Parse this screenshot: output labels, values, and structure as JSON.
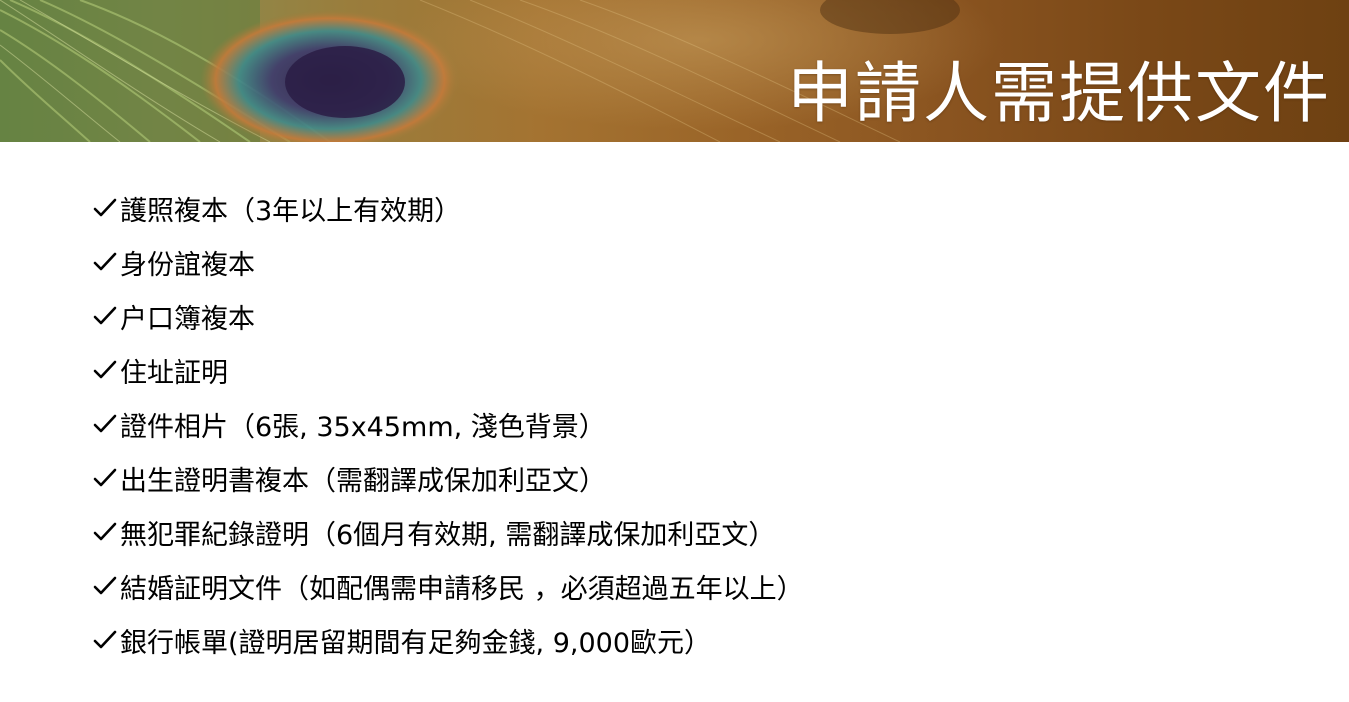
{
  "header": {
    "title": "申請人需提供文件",
    "background_icon": "peacock-feather-image",
    "accent_color": "#7a4817"
  },
  "documents": {
    "icon": "check-icon",
    "items": [
      "護照複本（3年以上有效期）",
      "身份誼複本",
      "户口簿複本",
      "住址証明",
      "證件相片（6張, 35x45mm, 淺色背景）",
      "出生證明書複本（需翻譯成保加利亞文）",
      "無犯罪紀錄證明（6個月有效期, 需翻譯成保加利亞文）",
      "結婚証明文件（如配偶需申請移民 ，必須超過五年以上）",
      "銀行帳單(證明居留期間有足夠金錢, 9,000歐元）"
    ]
  }
}
